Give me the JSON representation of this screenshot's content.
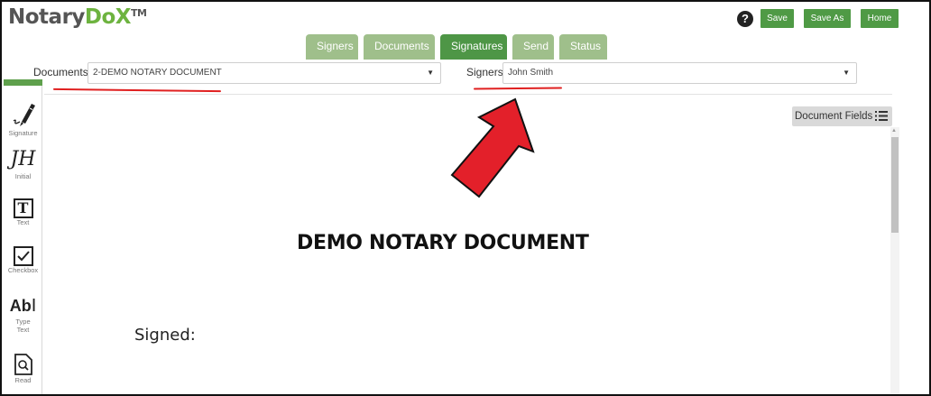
{
  "app": {
    "logo_part1": "Notary",
    "logo_part2": "DoX",
    "logo_tm": "TM"
  },
  "header": {
    "help_icon": "?",
    "save_label": "Save",
    "save_as_label": "Save As",
    "home_label": "Home"
  },
  "tabs": [
    {
      "label": "Signers",
      "active": false
    },
    {
      "label": "Documents",
      "active": false
    },
    {
      "label": "Signatures",
      "active": true
    },
    {
      "label": "Send",
      "active": false
    },
    {
      "label": "Status",
      "active": false
    }
  ],
  "selectors": {
    "documents_label": "Documents",
    "documents_value": "2-DEMO NOTARY DOCUMENT",
    "signers_label": "Signers",
    "signers_value": "John Smith"
  },
  "toolbar": {
    "items": [
      {
        "label": "Signature",
        "icon": "pen-icon"
      },
      {
        "label": "Initial",
        "icon": "initials-icon"
      },
      {
        "label": "Text",
        "icon": "text-box-icon"
      },
      {
        "label": "Checkbox",
        "icon": "checkbox-icon"
      },
      {
        "label_line1": "Type",
        "label_line2": "Text",
        "icon": "type-text-icon"
      },
      {
        "label": "Read",
        "icon": "read-doc-icon"
      }
    ],
    "initial_glyph": "JH",
    "text_glyph": "T",
    "ab_glyph": "Ab"
  },
  "document": {
    "fields_button_label": "Document Fields",
    "title": "DEMO NOTARY DOCUMENT",
    "signed_label": "Signed:"
  },
  "colors": {
    "brand_green": "#4e9646",
    "tab_inactive": "#9fbf8b",
    "annotation_red": "#e02020"
  }
}
